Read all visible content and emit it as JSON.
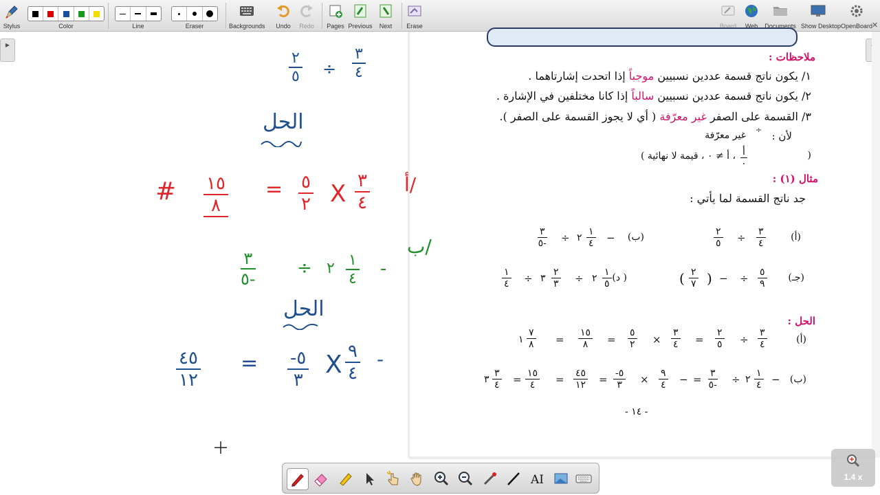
{
  "toolbar": {
    "stylus": "Stylus",
    "color": "Color",
    "line": "Line",
    "eraser": "Eraser",
    "backgrounds": "Backgrounds",
    "undo": "Undo",
    "redo": "Redo",
    "pages": "Pages",
    "previous": "Previous",
    "next": "Next",
    "erase": "Erase",
    "board": "Board",
    "web": "Web",
    "documents": "Documents",
    "show_desktop": "Show Desktop",
    "openboard": "OpenBoard",
    "colors": [
      "#000000",
      "#e00000",
      "#1a4fa0",
      "#1a9a1a",
      "#f0e000"
    ]
  },
  "document": {
    "notes_title": "ملاحظات :",
    "note1_num": "١/",
    "note1_pre": "يكون ناتج قسمة عددين نسبيين",
    "note1_hl": "موجباً",
    "note1_post": "إذا اتحدت إشارتاهما .",
    "note2_num": "٢/",
    "note2_pre": "يكون ناتج قسمة عددين نسبيين",
    "note2_hl": "سالباً",
    "note2_post": "إذا كانا مختلفين في الإشارة .",
    "note3_num": "٣/",
    "note3_pre": "القسمة على الصفر",
    "note3_hl": "غير معرّفة",
    "note3_post": "( أي لا يجوز القسمة على الصفر ).",
    "because": "لأن :",
    "undefined": "غير معرّفة",
    "infinite_line": "،  أ  ≠  ٠ ، قيمة لا نهائية )",
    "paren_open": "(",
    "frac_a": "أ",
    "frac_zero": "٠",
    "div_sign": "÷",
    "example_title": "مثال (١) :",
    "example_q": "جد ناتج القسمة لما يأتي :",
    "label_a": "(أ)",
    "label_b": "(ب)",
    "label_c": "(جـ)",
    "label_d": "( د)",
    "solution_title": "الحل :",
    "page_number": "- ١٤ -",
    "digits": {
      "n1": "١",
      "n2": "٢",
      "n3": "٣",
      "n4": "٤",
      "n5": "٥",
      "n7": "٧",
      "n8": "٨",
      "n9": "٩",
      "n12": "١٢",
      "n15": "١٥",
      "n45": "٤٥",
      "m3": "٣-",
      "m5": "٥-",
      "minus5": "-٥",
      "minus3": "-٣"
    },
    "ops": {
      "div": "÷",
      "times": "×",
      "eq": "=",
      "minus": "−"
    }
  },
  "handwriting": {
    "h_frac1_n": "٢",
    "h_frac1_d": "٥",
    "h_frac2_n": "٣",
    "h_frac2_d": "٤",
    "h_div": "÷",
    "h_sol": "الحل",
    "h_r_n1": "١٥",
    "h_r_d1": "٨",
    "h_r_n2": "٥",
    "h_r_d2": "٢",
    "h_r_n3": "٣",
    "h_r_d3": "٤",
    "h_eq": "=",
    "h_x": "X",
    "h_a": "أ/",
    "h_hash": "#",
    "h_g_n1": "٣",
    "h_g_d1": "٥-",
    "h_g_whole": "٢",
    "h_g_n2": "١",
    "h_g_d2": "٤",
    "h_g_minus": "-",
    "h_b": "ب/",
    "h_b_n1": "٤٥",
    "h_b_d1": "١٢",
    "h_b_n2": "-٥",
    "h_b_d2": "٣",
    "h_b_n3": "٩",
    "h_b_d3": "٤",
    "h_b_minus": "-",
    "red": "#e0262a",
    "green": "#1f8f2a",
    "blue": "#1f4f8f"
  },
  "zoom": {
    "level": "1.4 x"
  }
}
